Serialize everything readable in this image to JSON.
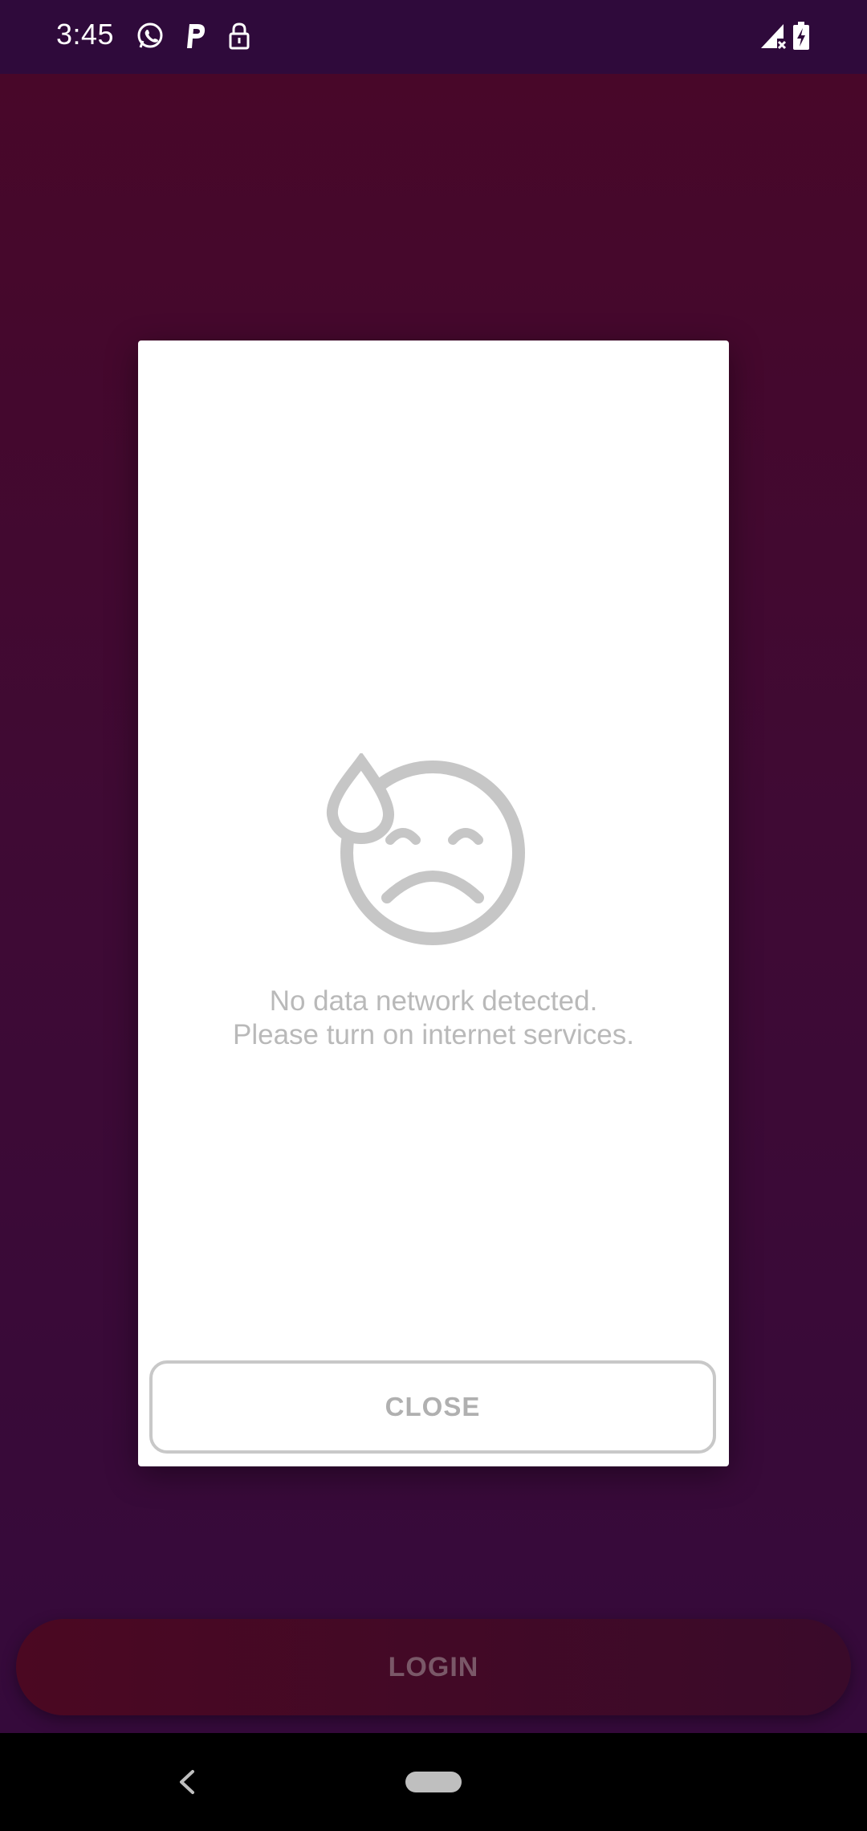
{
  "status_bar": {
    "time": "3:45",
    "icons_left": [
      "whatsapp-icon",
      "parking-p-icon",
      "lock-icon"
    ],
    "icons_right": [
      "signal-no-data-icon",
      "battery-charging-icon"
    ]
  },
  "dialog": {
    "icon": "sad-face-sweat-icon",
    "message_line1": "No data network detected.",
    "message_line2": "Please turn on internet services.",
    "close_label": "CLOSE"
  },
  "login_button_label": "LOGIN",
  "nav_bar": {
    "icons": [
      "back-icon",
      "home-pill-icon"
    ]
  },
  "colors": {
    "status_bar_bg": "#2f0a3b",
    "app_gradient_top": "#480729",
    "app_gradient_bottom": "#350a3b",
    "dialog_text": "#b9b9b9",
    "close_border": "#c8c8c8"
  }
}
